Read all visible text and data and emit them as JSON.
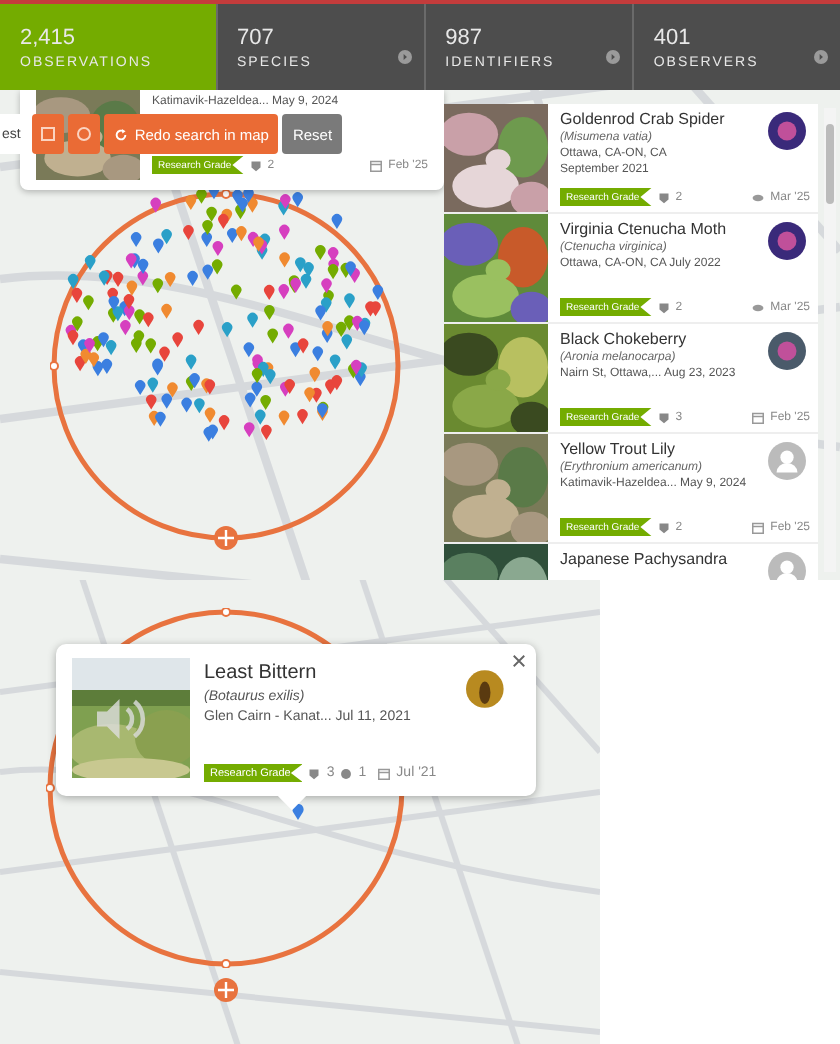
{
  "stats": [
    {
      "count": "2,415",
      "label": "OBSERVATIONS",
      "selected": true,
      "arrow": false
    },
    {
      "count": "707",
      "label": "SPECIES",
      "selected": false,
      "arrow": true
    },
    {
      "count": "987",
      "label": "IDENTIFIERS",
      "selected": false,
      "arrow": true
    },
    {
      "count": "401",
      "label": "OBSERVERS",
      "selected": false,
      "arrow": true
    }
  ],
  "preview_card": {
    "place_date": "Katimavik-Hazeldea... May 9, 2024",
    "grade": "Research Grade",
    "ids": "2",
    "date": "Feb '25"
  },
  "map_controls": {
    "cut_label": "est",
    "redo_button": "Redo search in map",
    "reset_button": "Reset"
  },
  "observations": [
    {
      "common_name": "Goldenrod Crab Spider",
      "scientific_name": "(Misumena vatia)",
      "location_lines": [
        "Ottawa, CA-ON, CA",
        "September 2021"
      ],
      "grade": "Research Grade",
      "ids": "2",
      "date": "Mar '25",
      "viewed": true,
      "avatar_photo": true
    },
    {
      "common_name": "Virginia Ctenucha Moth",
      "scientific_name": "(Ctenucha virginica)",
      "location_lines": [
        "Ottawa, CA-ON, CA July 2022"
      ],
      "grade": "Research Grade",
      "ids": "2",
      "date": "Mar '25",
      "viewed": true,
      "avatar_photo": true
    },
    {
      "common_name": "Black Chokeberry",
      "scientific_name": "(Aronia melanocarpa)",
      "location_lines": [
        "Nairn St, Ottawa,... Aug 23, 2023"
      ],
      "grade": "Research Grade",
      "ids": "3",
      "date": "Feb '25",
      "viewed": false,
      "avatar_photo": true
    },
    {
      "common_name": "Yellow Trout Lily",
      "scientific_name": "(Erythronium americanum)",
      "location_lines": [
        "Katimavik-Hazeldea... May 9, 2024"
      ],
      "grade": "Research Grade",
      "ids": "2",
      "date": "Feb '25",
      "viewed": false,
      "avatar_photo": false
    },
    {
      "common_name": "Japanese Pachysandra",
      "avatar_photo": false
    }
  ],
  "popup": {
    "common_name": "Least Bittern",
    "scientific_name": "(Botaurus exilis)",
    "place_date": "Glen Cairn - Kanat... Jul 11, 2021",
    "grade": "Research Grade",
    "ids": "3",
    "comments": "1",
    "date": "Jul '21",
    "sound": true
  }
}
